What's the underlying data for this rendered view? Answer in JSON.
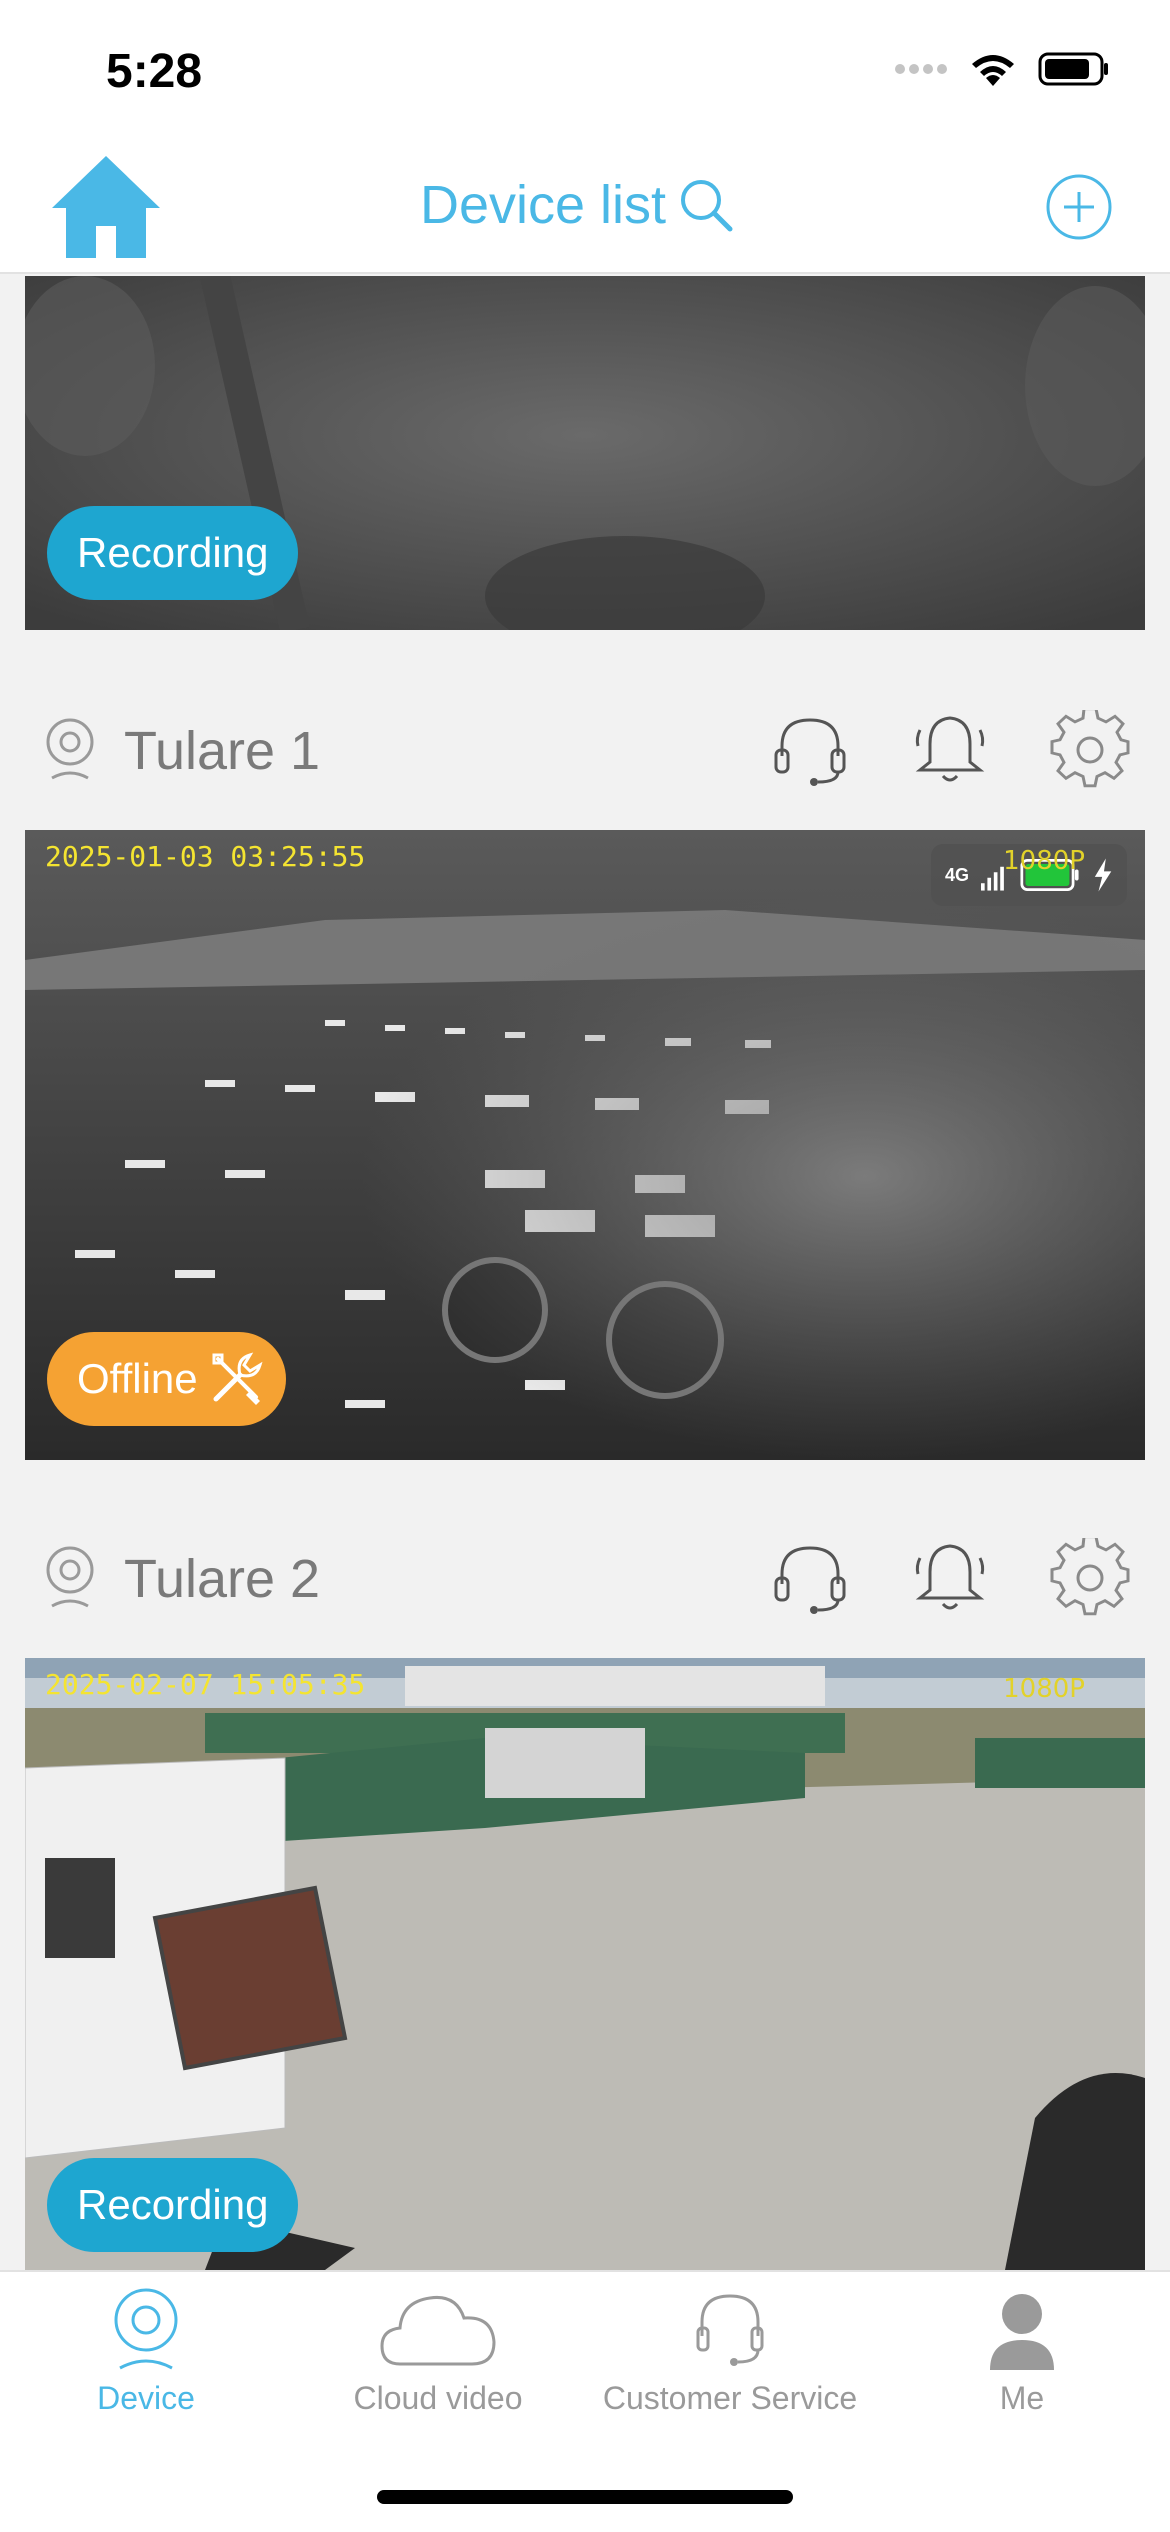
{
  "status_bar": {
    "time": "5:28"
  },
  "nav": {
    "title": "Device list"
  },
  "colors": {
    "accent": "#4ab8e6",
    "recording": "#1ea6d0",
    "offline": "#f5a233",
    "osd_text": "#f4e431"
  },
  "devices": [
    {
      "status_label": "Recording"
    },
    {
      "name": "Tulare 1",
      "status_label": "Offline",
      "osd_timestamp": "2025-01-03  03:25:55",
      "osd_resolution": "1080P",
      "network": "4G",
      "battery_level": 1.0,
      "charging": true
    },
    {
      "name": "Tulare 2",
      "status_label": "Recording",
      "osd_timestamp": "2025-02-07  15:05:35",
      "osd_resolution": "1080P"
    }
  ],
  "tabs": [
    {
      "label": "Device",
      "icon": "camera-icon",
      "active": true
    },
    {
      "label": "Cloud video",
      "icon": "cloud-icon",
      "active": false
    },
    {
      "label": "Customer Service",
      "icon": "headset-icon",
      "active": false
    },
    {
      "label": "Me",
      "icon": "person-icon",
      "active": false
    }
  ]
}
